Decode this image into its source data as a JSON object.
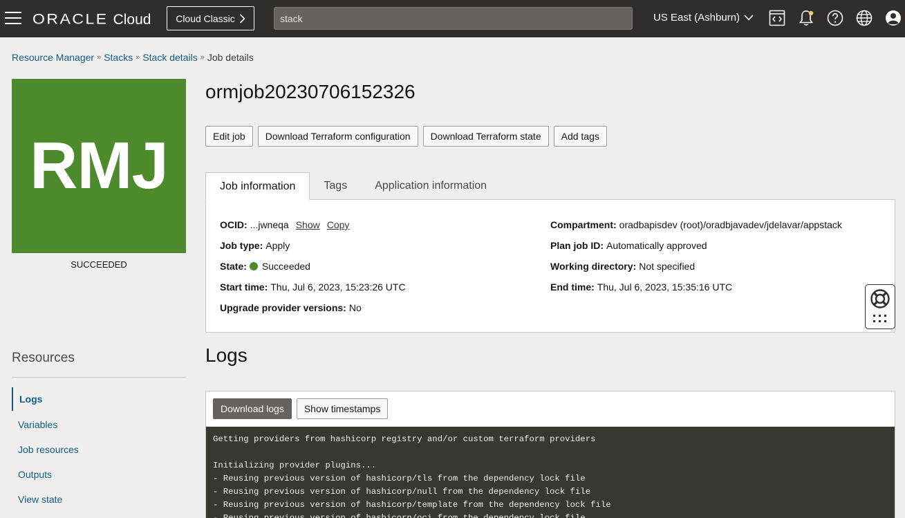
{
  "topbar": {
    "logo_oracle": "ORACLE",
    "logo_cloud": "Cloud",
    "classic_button": "Cloud Classic",
    "search_value": "stack",
    "region": "US East (Ashburn)",
    "icons": [
      "menu-icon",
      "code-editor-icon",
      "bell-icon",
      "help-icon",
      "globe-icon",
      "profile-icon"
    ]
  },
  "breadcrumb": {
    "items": [
      "Resource Manager",
      "Stacks",
      "Stack details"
    ],
    "current": "Job details"
  },
  "tile": {
    "initials": "RMJ",
    "status": "SUCCEEDED",
    "color": "#4d8a2c"
  },
  "resources": {
    "title": "Resources",
    "items": [
      "Logs",
      "Variables",
      "Job resources",
      "Outputs",
      "View state"
    ],
    "active": "Logs"
  },
  "job": {
    "title": "ormjob20230706152326",
    "actions": [
      "Edit job",
      "Download Terraform configuration",
      "Download Terraform state",
      "Add tags"
    ]
  },
  "tabs": {
    "items": [
      "Job information",
      "Tags",
      "Application information"
    ],
    "active": "Job information"
  },
  "info": {
    "ocid_label": "OCID:",
    "ocid_value": "...jwneqa",
    "show_link": "Show",
    "copy_link": "Copy",
    "job_type_label": "Job type:",
    "job_type_value": "Apply",
    "state_label": "State:",
    "state_value": "Succeeded",
    "start_label": "Start time:",
    "start_value": "Thu, Jul 6, 2023, 15:23:26 UTC",
    "upgrade_label": "Upgrade provider versions:",
    "upgrade_value": "No",
    "compartment_label": "Compartment:",
    "compartment_value": "oradbapisdev (root)/oradbjavadev/jdelavar/appstack",
    "plan_label": "Plan job ID:",
    "plan_value": "Automatically approved",
    "workdir_label": "Working directory:",
    "workdir_value": "Not specified",
    "end_label": "End time:",
    "end_value": "Thu, Jul 6, 2023, 15:35:16 UTC",
    "state_color": "#4d8a2c"
  },
  "logs": {
    "title": "Logs",
    "download_button": "Download logs",
    "timestamps_button": "Show timestamps",
    "lines": [
      "Getting providers from hashicorp registry and/or custom terraform providers",
      "",
      "Initializing provider plugins...",
      "- Reusing previous version of hashicorp/tls from the dependency lock file",
      "- Reusing previous version of hashicorp/null from the dependency lock file",
      "- Reusing previous version of hashicorp/template from the dependency lock file",
      "- Reusing previous version of hashicorp/oci from the dependency lock file"
    ]
  },
  "floating_help": {
    "icons": [
      "lifebuoy-icon",
      "grid-dots-icon"
    ]
  }
}
